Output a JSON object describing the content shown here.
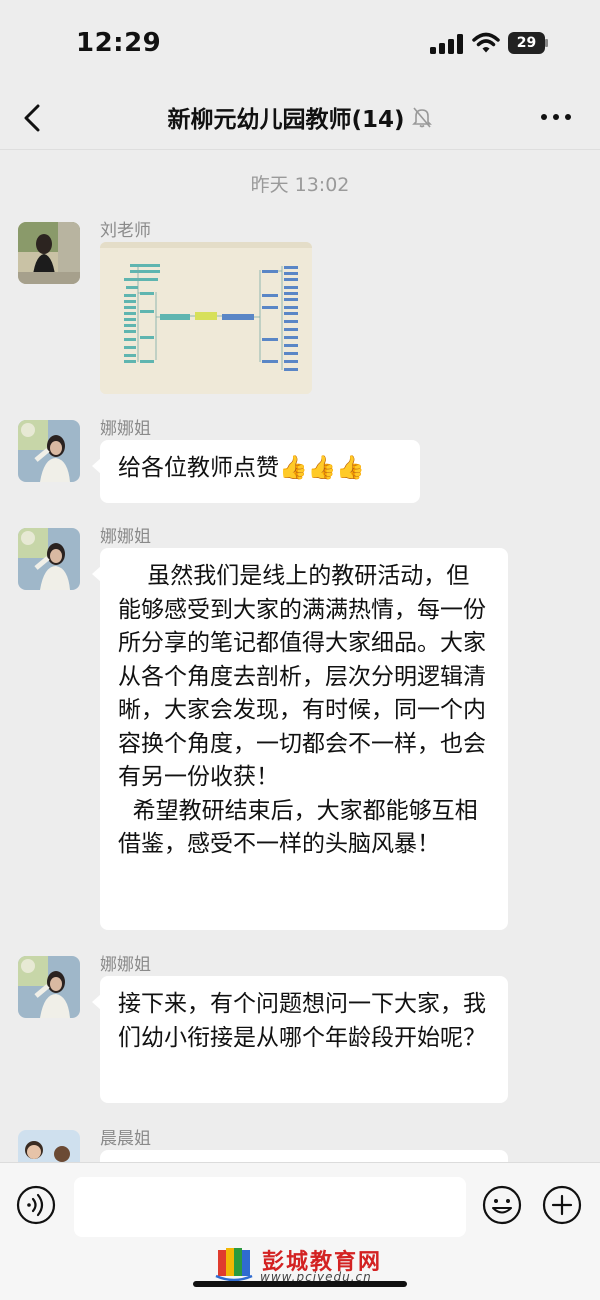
{
  "status_bar": {
    "time": "12:29",
    "battery": "29"
  },
  "nav": {
    "title": "新柳元幼儿园教师(14)"
  },
  "chat": {
    "timestamp": "昨天 13:02",
    "messages": [
      {
        "sender": "刘老师",
        "type": "image"
      },
      {
        "sender": "娜娜姐",
        "type": "text",
        "text": "给各位教师点赞👍👍👍"
      },
      {
        "sender": "娜娜姐",
        "type": "text",
        "text": "    虽然我们是线上的教研活动，但能够感受到大家的满满热情，每一份所分享的笔记都值得大家细品。大家从各个角度去剖析，层次分明逻辑清晰，大家会发现，有时候，同一个内容换个角度，一切都会不一样，也会有另一份收获！\n  希望教研结束后，大家都能够互相借鉴，感受不一样的头脑风暴！"
      },
      {
        "sender": "娜娜姐",
        "type": "text",
        "text": "接下来，有个问题想问一下大家，我们幼小衔接是从哪个年龄段开始呢？"
      },
      {
        "sender": "晨晨姐",
        "type": "text",
        "text": ""
      }
    ]
  },
  "input": {
    "value": "",
    "placeholder": ""
  },
  "watermark": {
    "name": "彭城教育网",
    "url": "www.pcjyedu.cn"
  },
  "icons": [
    "back-icon",
    "mute-bell-icon",
    "more-icon",
    "voice-icon",
    "emoji-icon",
    "plus-icon"
  ],
  "colors": {
    "background": "#ededed",
    "bubble": "#ffffff",
    "input_bar": "#f6f6f6"
  }
}
